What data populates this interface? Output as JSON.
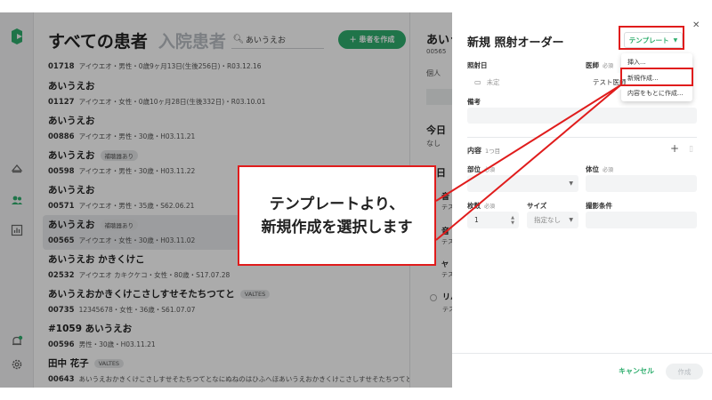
{
  "rail": {
    "icons": [
      "logo-icon",
      "home-icon",
      "patients-icon",
      "chart-icon",
      "notification-icon",
      "settings-icon"
    ]
  },
  "list": {
    "tab_all": "すべての患者",
    "tab_admitted": "入院患者",
    "search_value": "あいうえお",
    "create_button": "＋ 患者を作成",
    "patients": [
      {
        "name": "",
        "id": "01718",
        "info": "アイウエオ・男性・0歳9ヶ月13日(生後256日)・R03.12.16",
        "badge": "",
        "selected": false
      },
      {
        "name": "あいうえお",
        "id": "01127",
        "info": "アイウエオ・女性・0歳10ヶ月28日(生後332日)・R03.10.01",
        "badge": "",
        "selected": false
      },
      {
        "name": "あいうえお",
        "id": "00886",
        "info": "アイウエオ・男性・30歳・H03.11.21",
        "badge": "",
        "selected": false
      },
      {
        "name": "あいうえお",
        "id": "00598",
        "info": "アイウエオ・男性・30歳・H03.11.22",
        "badge": "補聴器あり",
        "selected": false
      },
      {
        "name": "あいうえお",
        "id": "00571",
        "info": "アイウエオ・男性・35歳・S62.06.21",
        "badge": "",
        "selected": false
      },
      {
        "name": "あいうえお",
        "id": "00565",
        "info": "アイウエオ・女性・30歳・H03.11.02",
        "badge": "補聴器あり",
        "selected": true
      },
      {
        "name": "あいうえお かきくけこ",
        "id": "02532",
        "info": "アイウエオ カキクケコ・女性・80歳・S17.07.28",
        "badge": "",
        "selected": false
      },
      {
        "name": "あいうえおかきくけこさしすせそたちつてと",
        "id": "00735",
        "info": "12345678・女性・36歳・S61.07.07",
        "badge": "VALTES",
        "selected": false
      },
      {
        "name": "#1059 あいうえお",
        "id": "00596",
        "info": "男性・30歳・H03.11.21",
        "badge": "",
        "selected": false
      },
      {
        "name": "田中 花子",
        "id": "00643",
        "info": "あいうえおかきくけこさしすせそたちつてとなにぬねのはひふへほあいうえおかきくけこさしすせそたちつてとなにぬねのはひふ",
        "badge": "VALTES",
        "selected": false
      }
    ]
  },
  "middle": {
    "name": "あいう",
    "id": "00565",
    "tab": "個人",
    "today_label": "今日",
    "none_label": "なし",
    "section_label": "昨日",
    "item1": "音",
    "item1_sub": "テス",
    "item2": "音",
    "item2_sub": "テス",
    "item3": "ヤ",
    "item3_sub": "テス",
    "item4": "リハ",
    "item4_sub": "テス"
  },
  "drawer": {
    "title": "新規 照射オーダー",
    "template_button": "テンプレート",
    "template_menu": [
      "挿入...",
      "新規作成...",
      "内容をもとに作成..."
    ],
    "date_label": "照射日",
    "date_placeholder": "未定",
    "doctor_label": "医師",
    "required": "必須",
    "doctor_value": "テスト医師",
    "remarks_label": "備考",
    "contents_label": "内容",
    "contents_count": "1つ目",
    "part_label": "部位",
    "body_position_label": "体位",
    "count_label": "枚数",
    "count_value": "1",
    "size_label": "サイズ",
    "size_value": "指定なし",
    "conditions_label": "撮影条件",
    "cancel_button": "キャンセル",
    "submit_button": "作成"
  },
  "annotation": {
    "line1": "テンプレートより、",
    "line2": "新規作成を選択します",
    "color": "#e01c1c"
  },
  "colors": {
    "accent": "#2fae6e",
    "annotation": "#e01c1c"
  }
}
